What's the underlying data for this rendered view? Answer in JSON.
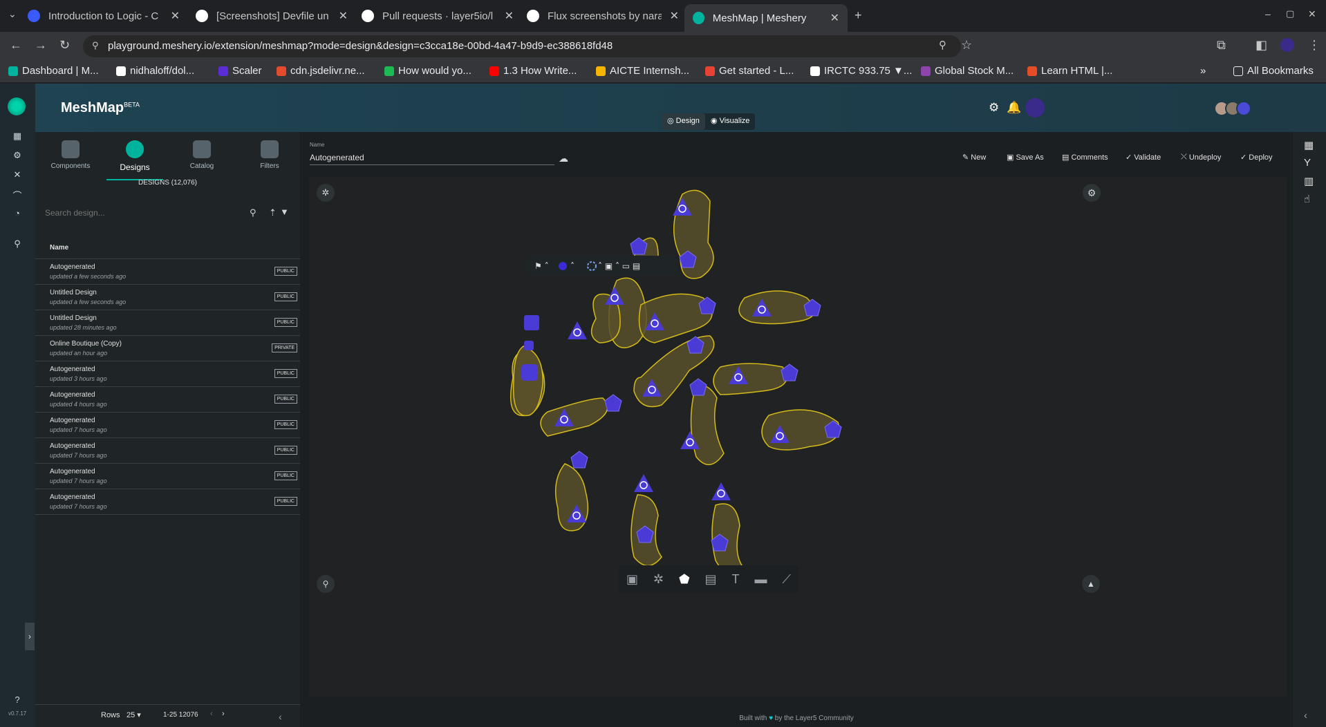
{
  "browser": {
    "tabs": [
      {
        "title": "Introduction to Logic - C",
        "color": "#3a5afc"
      },
      {
        "title": "[Screenshots] Devfile un",
        "color": "#ffffff"
      },
      {
        "title": "Pull requests · layer5io/l",
        "color": "#ffffff"
      },
      {
        "title": "Flux screenshots by nara",
        "color": "#ffffff"
      },
      {
        "title": "MeshMap | Meshery",
        "color": "#00b39f"
      }
    ],
    "url": "playground.meshery.io/extension/meshmap?mode=design&design=c3cca18e-00bd-4a47-b9d9-ec388618fd48",
    "bookmarks": [
      {
        "label": "Dashboard | M...",
        "color": "#00b39f"
      },
      {
        "label": "nidhaloff/dol...",
        "color": "#ffffff"
      },
      {
        "label": "Scaler",
        "color": "#5a2dd6"
      },
      {
        "label": "cdn.jsdelivr.ne...",
        "color": "#e34b2c"
      },
      {
        "label": "How would yo...",
        "color": "#1db954"
      },
      {
        "label": "1.3 How Write...",
        "color": "#ff0000"
      },
      {
        "label": "AICTE Internsh...",
        "color": "#f4b400"
      },
      {
        "label": "Get started - L...",
        "color": "#e94235"
      },
      {
        "label": "IRCTC 933.75 ▼...",
        "color": "#ffffff"
      },
      {
        "label": "Global Stock M...",
        "color": "#8e44ad"
      },
      {
        "label": "Learn HTML |...",
        "color": "#e44d26"
      }
    ],
    "all_bookmarks": "All Bookmarks"
  },
  "app": {
    "brand": "MeshMap",
    "brand_sup": "BETA",
    "mode_design": "Design",
    "mode_visualize": "Visualize",
    "version": "v0.7.17"
  },
  "panel": {
    "tabs": [
      {
        "label": "Components"
      },
      {
        "label": "Designs"
      },
      {
        "label": "Catalog"
      },
      {
        "label": "Filters"
      }
    ],
    "count_label": "DESIGNS (12,076)",
    "search_placeholder": "Search design...",
    "column_name": "Name",
    "rows": [
      {
        "name": "Autogenerated",
        "updated": "updated a few seconds ago",
        "badge": "PUBLIC"
      },
      {
        "name": "Untitled Design",
        "updated": "updated a few seconds ago",
        "badge": "PUBLIC"
      },
      {
        "name": "Untitled Design",
        "updated": "updated 28 minutes ago",
        "badge": "PUBLIC"
      },
      {
        "name": "Online Boutique (Copy)",
        "updated": "updated an hour ago",
        "badge": "PRIVATE"
      },
      {
        "name": "Autogenerated",
        "updated": "updated 3 hours ago",
        "badge": "PUBLIC"
      },
      {
        "name": "Autogenerated",
        "updated": "updated 4 hours ago",
        "badge": "PUBLIC"
      },
      {
        "name": "Autogenerated",
        "updated": "updated 7 hours ago",
        "badge": "PUBLIC"
      },
      {
        "name": "Autogenerated",
        "updated": "updated 7 hours ago",
        "badge": "PUBLIC"
      },
      {
        "name": "Autogenerated",
        "updated": "updated 7 hours ago",
        "badge": "PUBLIC"
      },
      {
        "name": "Autogenerated",
        "updated": "updated 7 hours ago",
        "badge": "PUBLIC"
      }
    ],
    "rows_label": "Rows",
    "rows_value": "25",
    "range": "1-25 12076"
  },
  "editor": {
    "name_label": "Name",
    "name_value": "Autogenerated",
    "actions": [
      "New",
      "Save As",
      "Comments",
      "Validate",
      "Undeploy",
      "Deploy"
    ],
    "footer_left": "Built with",
    "footer_right": "by the Layer5 Community"
  },
  "colors": {
    "accent": "#00b39f",
    "node": "#4b3bd6",
    "group_fill": "#5a5226",
    "group_stroke": "#d4bb1a"
  }
}
